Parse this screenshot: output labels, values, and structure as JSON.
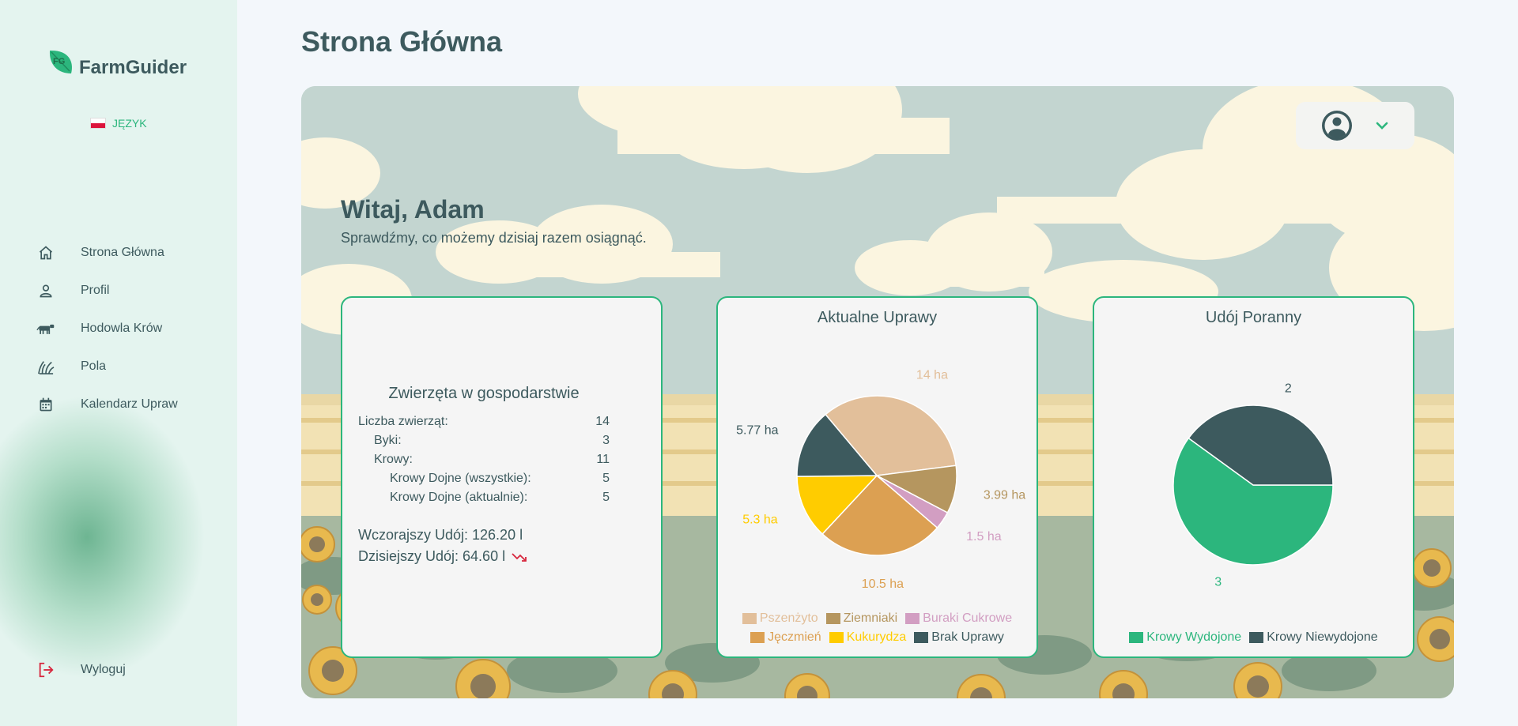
{
  "app": {
    "name": "FarmGuider",
    "logo_initials": "FG",
    "language_label": "JĘZYK",
    "colors": {
      "accent": "#2cb67d",
      "dark": "#3d5a5e",
      "danger": "#d7263d"
    }
  },
  "sidebar": {
    "items": [
      {
        "label": "Strona Główna",
        "icon": "home-icon"
      },
      {
        "label": "Profil",
        "icon": "user-icon"
      },
      {
        "label": "Hodowla Krów",
        "icon": "cow-icon"
      },
      {
        "label": "Pola",
        "icon": "grass-icon"
      },
      {
        "label": "Kalendarz Upraw",
        "icon": "calendar-icon"
      }
    ],
    "logout_label": "Wyloguj"
  },
  "page": {
    "title": "Strona Główna"
  },
  "hero": {
    "welcome": "Witaj, Adam",
    "subtitle": "Sprawdźmy, co możemy dzisiaj razem osiągnąć."
  },
  "animals": {
    "title": "Zwierzęta w gospodarstwie",
    "rows": [
      {
        "label": "Liczba zwierząt:",
        "value": "14"
      },
      {
        "label": "Byki:",
        "value": "3"
      },
      {
        "label": "Krowy:",
        "value": "11"
      },
      {
        "label": "Krowy Dojne (wszystkie):",
        "value": "5"
      },
      {
        "label": "Krowy Dojne (aktualnie):",
        "value": "5"
      }
    ],
    "yesterday_milk": "Wczorajszy Udój: 126.20 l",
    "today_milk": "Dzisiejszy Udój: 64.60 l",
    "trend_icon": "trending-down-icon"
  },
  "chart_data": [
    {
      "type": "pie",
      "title": "Aktualne Uprawy",
      "categories": [
        "Pszenżyto",
        "Ziemniaki",
        "Buraki Cukrowe",
        "Jęczmień",
        "Kukurydza",
        "Brak Uprawy"
      ],
      "values": [
        14,
        3.99,
        1.5,
        10.5,
        5.3,
        5.77
      ],
      "data_labels": [
        "14 ha",
        "3.99 ha",
        "1.5 ha",
        "10.5 ha",
        "5.3 ha",
        "5.77 ha"
      ],
      "colors": [
        "#e2bf9a",
        "#b5965f",
        "#d29ec2",
        "#dca052",
        "#ffcc00",
        "#3d5a5e"
      ],
      "label_colors": [
        "#e2bf9a",
        "#b5965f",
        "#d29ec2",
        "#dca052",
        "#ffcc00",
        "#3d5a5e"
      ],
      "legend": "bottom"
    },
    {
      "type": "pie",
      "title": "Udój Poranny",
      "categories": [
        "Krowy Wydojone",
        "Krowy Niewydojone"
      ],
      "values": [
        3,
        2
      ],
      "data_labels": [
        "3",
        "2"
      ],
      "colors": [
        "#2cb67d",
        "#3d5a5e"
      ],
      "label_colors": [
        "#2cb67d",
        "#3d5a5e"
      ],
      "legend": "bottom"
    }
  ]
}
